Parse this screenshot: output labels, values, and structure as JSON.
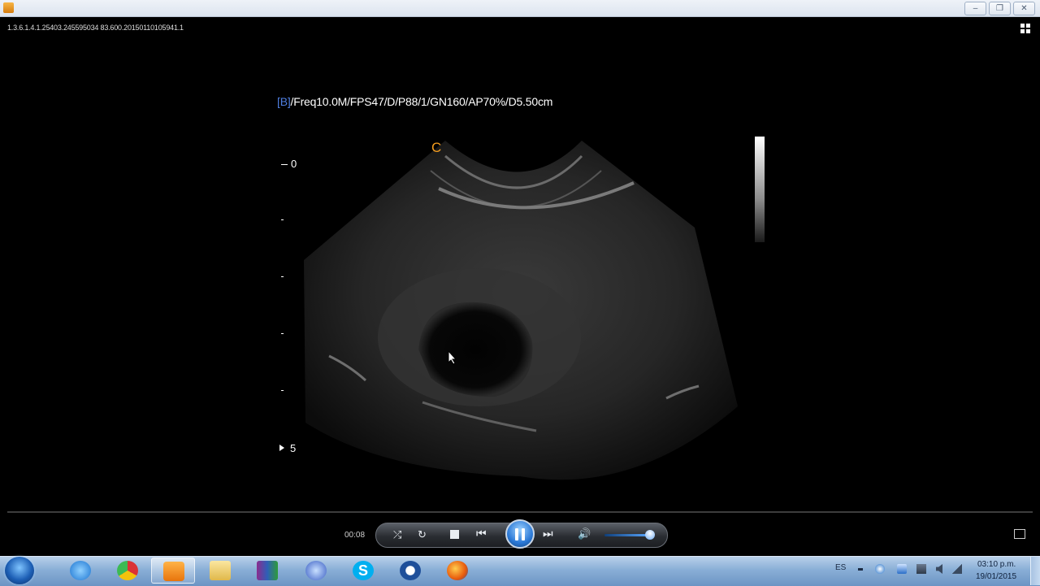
{
  "window": {
    "media_id": "1.3.6.1.4.1.25403.245595034 83.600.20150110105941.1",
    "controls": [
      "minimize-icon",
      "restore-icon",
      "close-icon"
    ]
  },
  "ultrasound": {
    "mode": "[B]",
    "params": "/Freq10.0M/FPS47/D/P88/1/GN160/AP70%/D5.50cm",
    "orientation_marker": "C",
    "depth_top": "0",
    "depth_bottom": "5"
  },
  "player": {
    "time": "00:08",
    "state": "playing",
    "volume_level": 0.85,
    "icons": [
      "shuffle-icon",
      "repeat-icon",
      "stop-icon",
      "previous-icon",
      "pause-icon",
      "next-icon",
      "volume-icon",
      "switch-to-library-icon"
    ]
  },
  "taskbar": {
    "apps": [
      "internet-explorer",
      "chrome",
      "media-player",
      "file-explorer",
      "winrar",
      "firefox-aurora",
      "skype",
      "ccleaner-like",
      "firefox"
    ],
    "active_app": "media-player",
    "language": "ES",
    "clock_time": "03:10 p.m.",
    "clock_date": "19/01/2015"
  }
}
